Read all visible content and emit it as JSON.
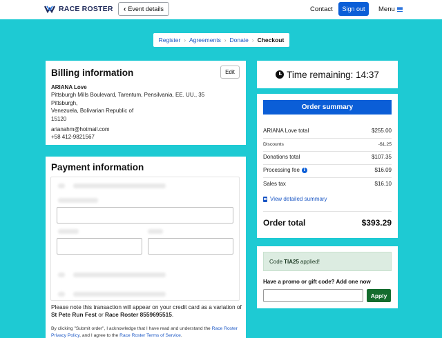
{
  "header": {
    "logo_text": "RACE ROSTER",
    "event_details_label": "Event details",
    "contact_label": "Contact",
    "signout_label": "Sign out",
    "menu_label": "Menu",
    "accent_color": "#0b5ed7"
  },
  "breadcrumb": {
    "items": [
      "Register",
      "Agreements",
      "Donate",
      "Checkout"
    ],
    "active": "Checkout"
  },
  "billing": {
    "title": "Billing information",
    "edit_label": "Edit",
    "name": "ARIANA Love",
    "address_line1": "Pittsburgh Mills Boulevard, Tarentum, Pensilvania, EE. UU., 35",
    "address_line2": "Pittsburgh,",
    "address_line3": "Venezuela, Bolivarian Republic of",
    "postal": "15120",
    "email": "arianahm@hotmail.com",
    "phone": "+58 412-9821567"
  },
  "payment": {
    "title": "Payment information",
    "note_prefix": "Please note this transaction will appear on your credit card as a variation of",
    "descriptor1": "St Pete Run Fest",
    "or_word": "or",
    "descriptor2": "Race Roster 8559695515",
    "terms_prefix": "By clicking \"Submit order\", I acknowledge that I have read and understand the",
    "terms_link1": "Race Roster Privacy Policy",
    "terms_mid": ", and I agree to the",
    "terms_link2": "Race Roster Terms of Service",
    "terms_end": "."
  },
  "timer": {
    "label": "Time remaining: 14:37"
  },
  "summary": {
    "title": "Order summary",
    "rows": [
      {
        "label": "ARIANA Love total",
        "value": "$255.00"
      },
      {
        "label": "Discounts",
        "value": "-$1.25"
      },
      {
        "label": "Donations total",
        "value": "$107.35"
      },
      {
        "label": "Processing fee",
        "value": "$16.09"
      },
      {
        "label": "Sales tax",
        "value": "$16.10"
      }
    ],
    "detail_link": "View detailed summary",
    "total_label": "Order total",
    "total_value": "$393.29"
  },
  "promo": {
    "applied_prefix": "Code",
    "applied_code": "TIA25",
    "applied_suffix": "applied!",
    "label": "Have a promo or gift code? Add one now",
    "input_value": "",
    "apply_label": "Apply"
  }
}
